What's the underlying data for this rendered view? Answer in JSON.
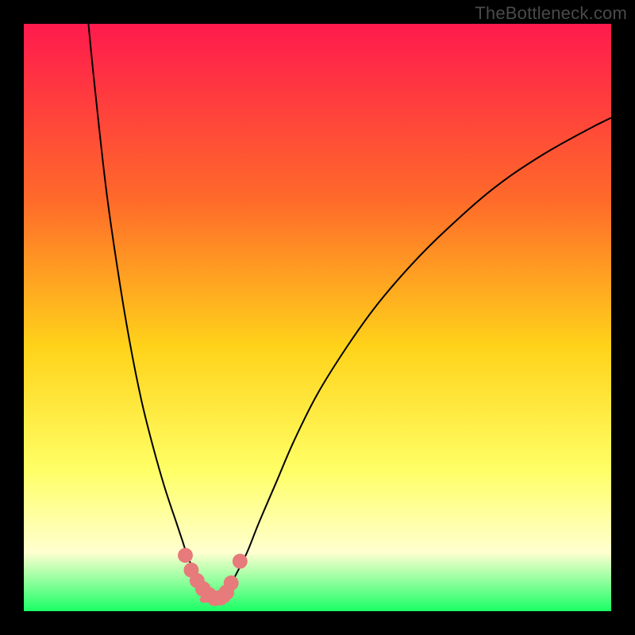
{
  "watermark": "TheBottleneck.com",
  "colors": {
    "frame": "#000000",
    "gradient_top": "#ff1a4d",
    "gradient_mid1": "#ff6a2a",
    "gradient_mid2": "#ffd31a",
    "gradient_mid3": "#ffff66",
    "gradient_pale": "#ffffd0",
    "gradient_bottom": "#1aff66",
    "curve": "#000000",
    "marker_fill": "#e77a7a",
    "marker_stroke": "#c95a5a"
  },
  "chart_data": {
    "type": "line",
    "title": "",
    "xlabel": "",
    "ylabel": "",
    "xlim": [
      0,
      100
    ],
    "ylim": [
      0,
      100
    ],
    "series": [
      {
        "name": "left-branch",
        "x": [
          11,
          12,
          14,
          16,
          18,
          20,
          22,
          24,
          26,
          27,
          28,
          29,
          30,
          31,
          32,
          33
        ],
        "y": [
          100,
          90,
          72,
          58,
          46,
          36,
          28,
          21,
          15,
          12,
          9,
          7,
          5,
          3.5,
          2.5,
          2
        ]
      },
      {
        "name": "right-branch",
        "x": [
          33,
          34,
          35,
          36,
          38,
          40,
          43,
          46,
          50,
          55,
          60,
          66,
          72,
          80,
          88,
          96,
          100
        ],
        "y": [
          2,
          2.5,
          4,
          6,
          10,
          15,
          22,
          29,
          37,
          45,
          52,
          59,
          65,
          72,
          77.5,
          82,
          84
        ]
      }
    ],
    "markers": [
      {
        "x": 27.5,
        "y": 9.5,
        "r": 1.2
      },
      {
        "x": 28.5,
        "y": 7.0,
        "r": 1.2
      },
      {
        "x": 29.5,
        "y": 5.2,
        "r": 1.2
      },
      {
        "x": 30.5,
        "y": 3.8,
        "r": 1.3
      },
      {
        "x": 31.5,
        "y": 2.8,
        "r": 1.3
      },
      {
        "x": 32.5,
        "y": 2.2,
        "r": 1.3
      },
      {
        "x": 33.5,
        "y": 2.3,
        "r": 1.3
      },
      {
        "x": 34.5,
        "y": 3.2,
        "r": 1.3
      },
      {
        "x": 35.3,
        "y": 4.8,
        "r": 1.2
      },
      {
        "x": 36.8,
        "y": 8.5,
        "r": 1.2
      }
    ],
    "flat_bottom": {
      "x0": 30.5,
      "x1": 34.5,
      "y": 2
    }
  }
}
